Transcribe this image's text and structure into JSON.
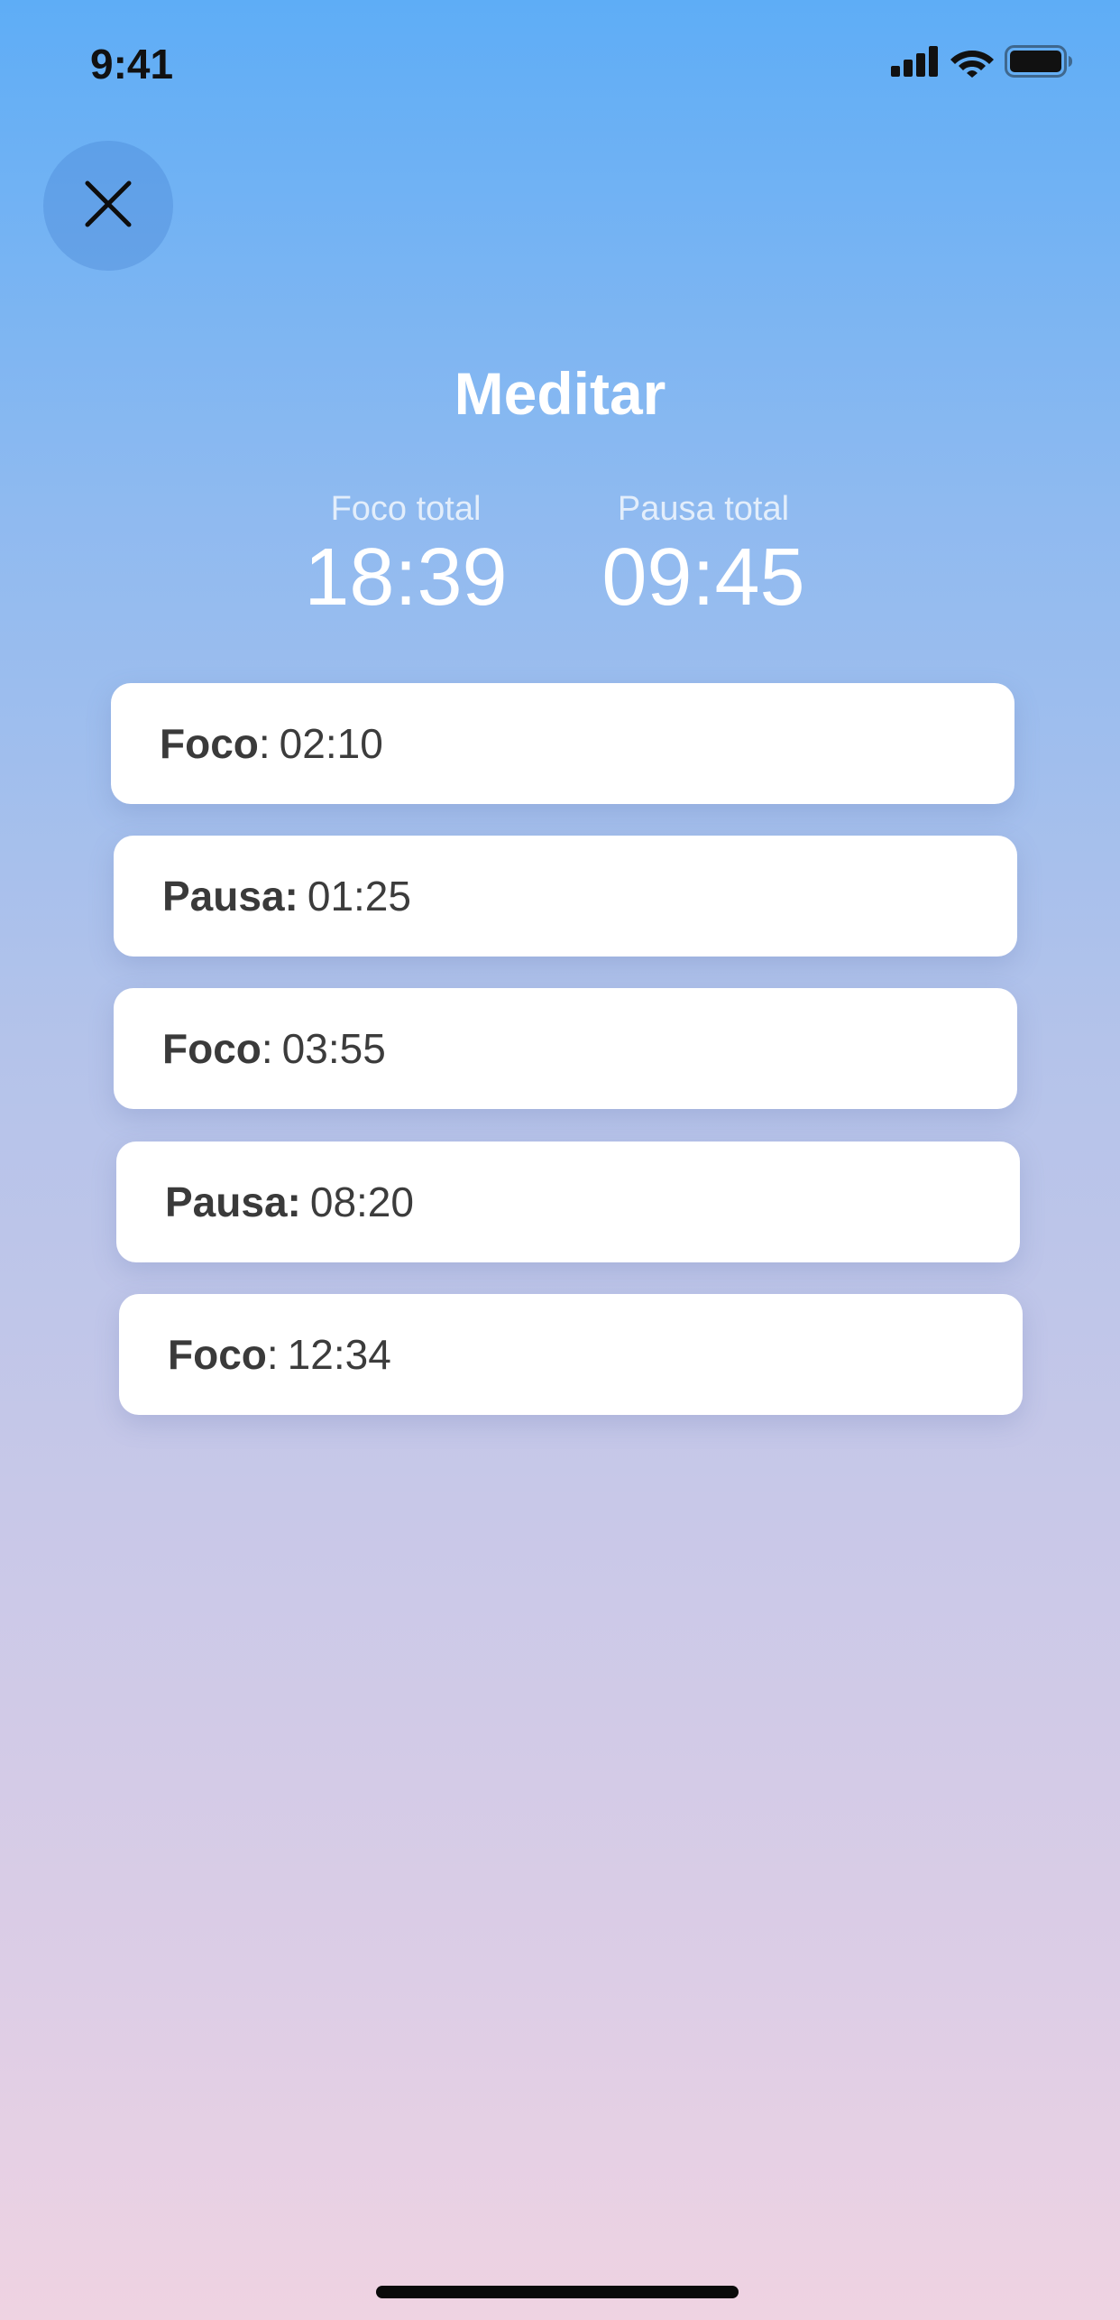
{
  "status_bar": {
    "time": "9:41",
    "icons": [
      "signal-icon",
      "wifi-icon",
      "battery-icon"
    ]
  },
  "header": {
    "close_icon": "close-icon",
    "title": "Meditar"
  },
  "totals": {
    "focus_label": "Foco total",
    "focus_value": "18:39",
    "pause_label": "Pausa total",
    "pause_value": "09:45"
  },
  "sessions": [
    {
      "type": "Foco",
      "sep": ":",
      "time": "02:10"
    },
    {
      "type": "Pausa:",
      "sep": "",
      "time": "01:25"
    },
    {
      "type": "Foco",
      "sep": ":",
      "time": "03:55"
    },
    {
      "type": "Pausa:",
      "sep": "",
      "time": "08:20"
    },
    {
      "type": "Foco",
      "sep": ":",
      "time": "12:34"
    }
  ],
  "colors": {
    "gradient_top": "#5eadf6",
    "gradient_bottom": "#efd3e2",
    "card_background": "#ffffff",
    "text_dark": "#3c3c3c"
  }
}
